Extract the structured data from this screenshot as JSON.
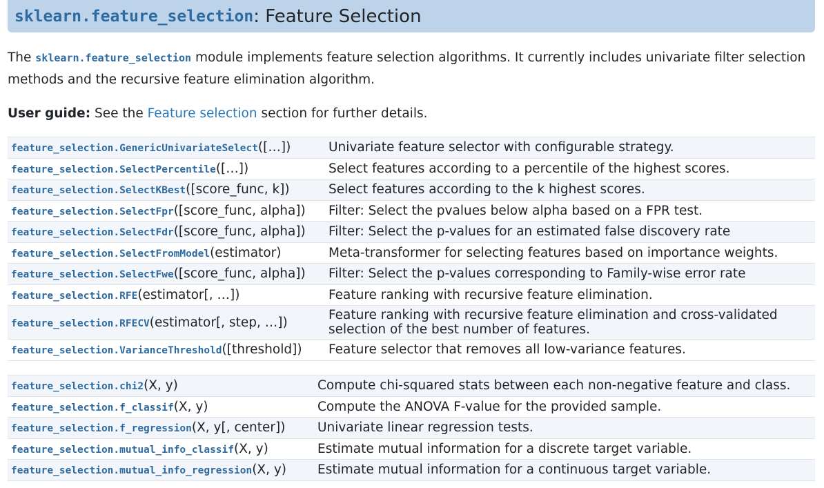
{
  "header": {
    "module": "sklearn.feature_selection",
    "rest": ": Feature Selection"
  },
  "intro": {
    "prefix": "The ",
    "module": "sklearn.feature_selection",
    "text": " module implements feature selection algorithms. It currently includes univariate filter selection methods and the recursive feature elimination algorithm."
  },
  "guide": {
    "label": "User guide:",
    "before": " See the ",
    "link": "Feature selection",
    "after": " section for further details."
  },
  "table1": {
    "rows": [
      {
        "name": "feature_selection.GenericUnivariateSelect",
        "args": "([…])",
        "desc": "Univariate feature selector with configurable strategy."
      },
      {
        "name": "feature_selection.SelectPercentile",
        "args": "([…])",
        "desc": "Select features according to a percentile of the highest scores."
      },
      {
        "name": "feature_selection.SelectKBest",
        "args": "([score_func, k])",
        "desc": "Select features according to the k highest scores."
      },
      {
        "name": "feature_selection.SelectFpr",
        "args": "([score_func, alpha])",
        "desc": "Filter: Select the pvalues below alpha based on a FPR test."
      },
      {
        "name": "feature_selection.SelectFdr",
        "args": "([score_func, alpha])",
        "desc": "Filter: Select the p-values for an estimated false discovery rate"
      },
      {
        "name": "feature_selection.SelectFromModel",
        "args": "(estimator)",
        "desc": "Meta-transformer for selecting features based on importance weights."
      },
      {
        "name": "feature_selection.SelectFwe",
        "args": "([score_func, alpha])",
        "desc": "Filter: Select the p-values corresponding to Family-wise error rate"
      },
      {
        "name": "feature_selection.RFE",
        "args": "(estimator[, …])",
        "desc": "Feature ranking with recursive feature elimination."
      },
      {
        "name": "feature_selection.RFECV",
        "args": "(estimator[, step, …])",
        "desc": "Feature ranking with recursive feature elimination and cross-validated selection of the best number of features."
      },
      {
        "name": "feature_selection.VarianceThreshold",
        "args": "([threshold])",
        "desc": "Feature selector that removes all low-variance features."
      }
    ]
  },
  "table2": {
    "rows": [
      {
        "name": "feature_selection.chi2",
        "args": "(X, y)",
        "desc": "Compute chi-squared stats between each non-negative feature and class."
      },
      {
        "name": "feature_selection.f_classif",
        "args": "(X, y)",
        "desc": "Compute the ANOVA F-value for the provided sample."
      },
      {
        "name": "feature_selection.f_regression",
        "args": "(X, y[, center])",
        "desc": "Univariate linear regression tests."
      },
      {
        "name": "feature_selection.mutual_info_classif",
        "args": "(X, y)",
        "desc": "Estimate mutual information for a discrete target variable."
      },
      {
        "name": "feature_selection.mutual_info_regression",
        "args": "(X, y)",
        "desc": "Estimate mutual information for a continuous target variable."
      }
    ]
  }
}
